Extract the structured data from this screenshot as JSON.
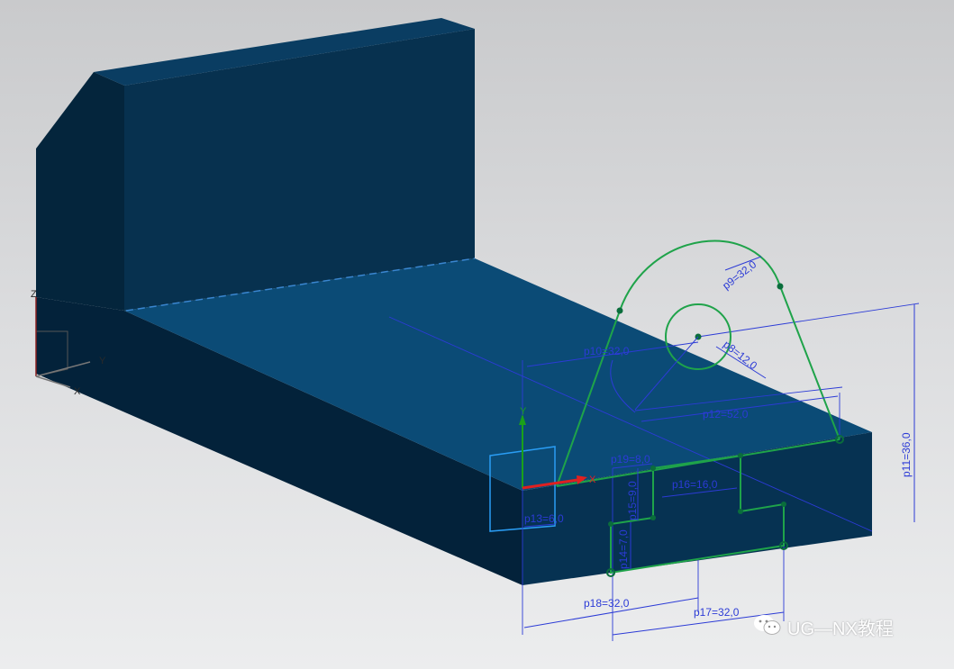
{
  "colors": {
    "model_face_front": "#052e4a",
    "model_face_top": "#0b4c78",
    "model_face_side": "#04263e",
    "sketch": "#1fa34a",
    "dimension": "#2c3bd6",
    "csys_x": "#e02020",
    "csys_y": "#1aa01a",
    "sketch_plane": "#2a9df4"
  },
  "csys": {
    "x_label": "X",
    "y_label": "Y",
    "z_label": "Z"
  },
  "sketch_axes": {
    "x_label": "X",
    "y_label": "Y"
  },
  "dimensions": {
    "p9": "p9=32,0",
    "p8": "p8=12,0",
    "p10": "p10=32,0",
    "p11": "p11=36,0",
    "p12": "p12=52,0",
    "p13": "p13=6,0",
    "p14": "p14=7,0",
    "p15": "p15=9,0",
    "p16": "p16=16,0",
    "p17": "p17=32,0",
    "p18": "p18=32,0",
    "p19": "p19=8,0"
  },
  "watermark": {
    "text": "UG—NX教程",
    "icon": "wechat-icon"
  }
}
